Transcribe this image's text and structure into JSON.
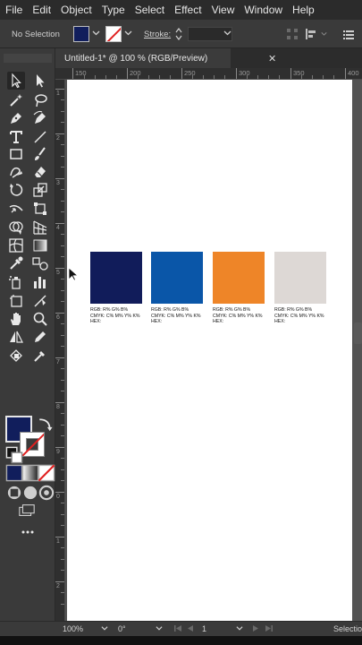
{
  "menu": [
    "File",
    "Edit",
    "Object",
    "Type",
    "Select",
    "Effect",
    "View",
    "Window",
    "Help"
  ],
  "controlbar": {
    "selection_text": "No Selection",
    "stroke_label": "Stroke:",
    "fill_color": "#111e5c",
    "stroke_color": "none"
  },
  "document": {
    "tab_title": "Untitled-1* @ 100 % (RGB/Preview)",
    "close_glyph": "✕"
  },
  "ruler_h_labels": [
    "150",
    "200",
    "250",
    "300",
    "350",
    "400"
  ],
  "ruler_v_labels": [
    "1",
    "2",
    "3",
    "4",
    "5",
    "6",
    "7",
    "8",
    "9",
    "0",
    "1",
    "2"
  ],
  "swatches": [
    {
      "color": "#111c5a",
      "rgb": "RGB:  R% G% B%",
      "cmyk": "CMYK: C% M% Y% K%",
      "hex": "HEX:"
    },
    {
      "color": "#0a56a8",
      "rgb": "RGB:  R% G% B%",
      "cmyk": "CMYK: C% M% Y% K%",
      "hex": "HEX:"
    },
    {
      "color": "#ee8528",
      "rgb": "RGB:  R% G% B%",
      "cmyk": "CMYK: C% M% Y% K%",
      "hex": "HEX:"
    },
    {
      "color": "#ddd8d5",
      "rgb": "RGB:  R% G% B%",
      "cmyk": "CMYK: C% M% Y% K%",
      "hex": "HEX:"
    }
  ],
  "status": {
    "zoom": "100%",
    "rotation": "0°",
    "artboard_num": "1",
    "tool_name": "Selection"
  },
  "colors": {
    "accent_fill": "#111e5c",
    "stroke_none": "#e02020"
  }
}
